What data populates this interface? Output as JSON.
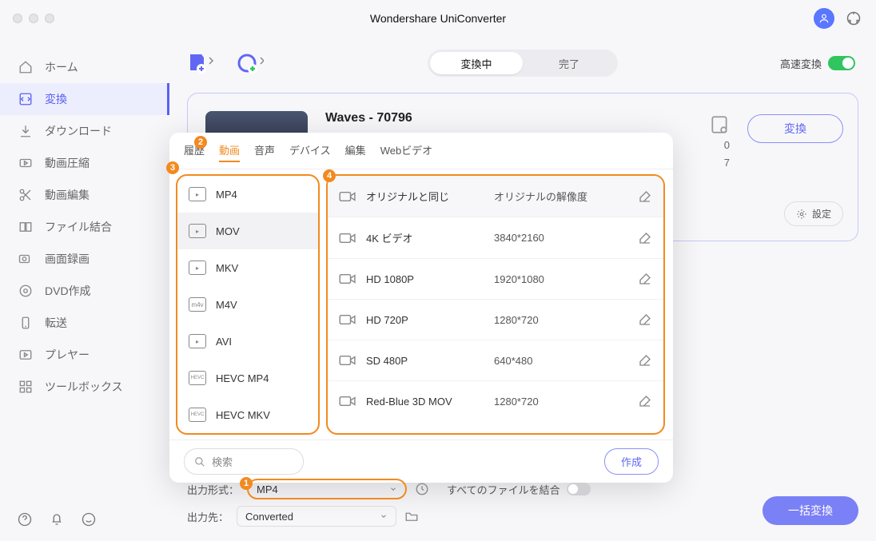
{
  "app_title": "Wondershare UniConverter",
  "sidebar": {
    "items": [
      {
        "label": "ホーム"
      },
      {
        "label": "変換"
      },
      {
        "label": "ダウンロード"
      },
      {
        "label": "動画圧縮"
      },
      {
        "label": "動画編集"
      },
      {
        "label": "ファイル結合"
      },
      {
        "label": "画面録画"
      },
      {
        "label": "DVD作成"
      },
      {
        "label": "転送"
      },
      {
        "label": "プレヤー"
      },
      {
        "label": "ツールボックス"
      }
    ],
    "active_index": 1
  },
  "toolbar": {
    "tabs": {
      "converting": "変換中",
      "done": "完了"
    },
    "speed_label": "高速変換"
  },
  "file": {
    "title": "Waves - 70796",
    "meta_top": "0",
    "meta_bottom": "7",
    "convert_label": "変換",
    "settings_label": "設定"
  },
  "popup": {
    "tabs": [
      "履歴",
      "動画",
      "音声",
      "デバイス",
      "編集",
      "Webビデオ"
    ],
    "active_tab": 1,
    "formats": [
      "MP4",
      "MOV",
      "MKV",
      "M4V",
      "AVI",
      "HEVC MP4",
      "HEVC MKV"
    ],
    "active_format": 1,
    "resolutions": [
      {
        "name": "オリジナルと同じ",
        "value": "オリジナルの解像度"
      },
      {
        "name": "4K ビデオ",
        "value": "3840*2160"
      },
      {
        "name": "HD 1080P",
        "value": "1920*1080"
      },
      {
        "name": "HD 720P",
        "value": "1280*720"
      },
      {
        "name": "SD 480P",
        "value": "640*480"
      },
      {
        "name": "Red-Blue 3D MOV",
        "value": "1280*720"
      }
    ],
    "search_placeholder": "検索",
    "create_label": "作成"
  },
  "bottom": {
    "format_label": "出力形式：",
    "format_value": "MP4",
    "dest_label": "出力先：",
    "dest_value": "Converted",
    "merge_label": "すべてのファイルを結合",
    "batch_label": "一括変換"
  },
  "annotations": {
    "b1": "1",
    "b2": "2",
    "b3": "3",
    "b4": "4"
  }
}
